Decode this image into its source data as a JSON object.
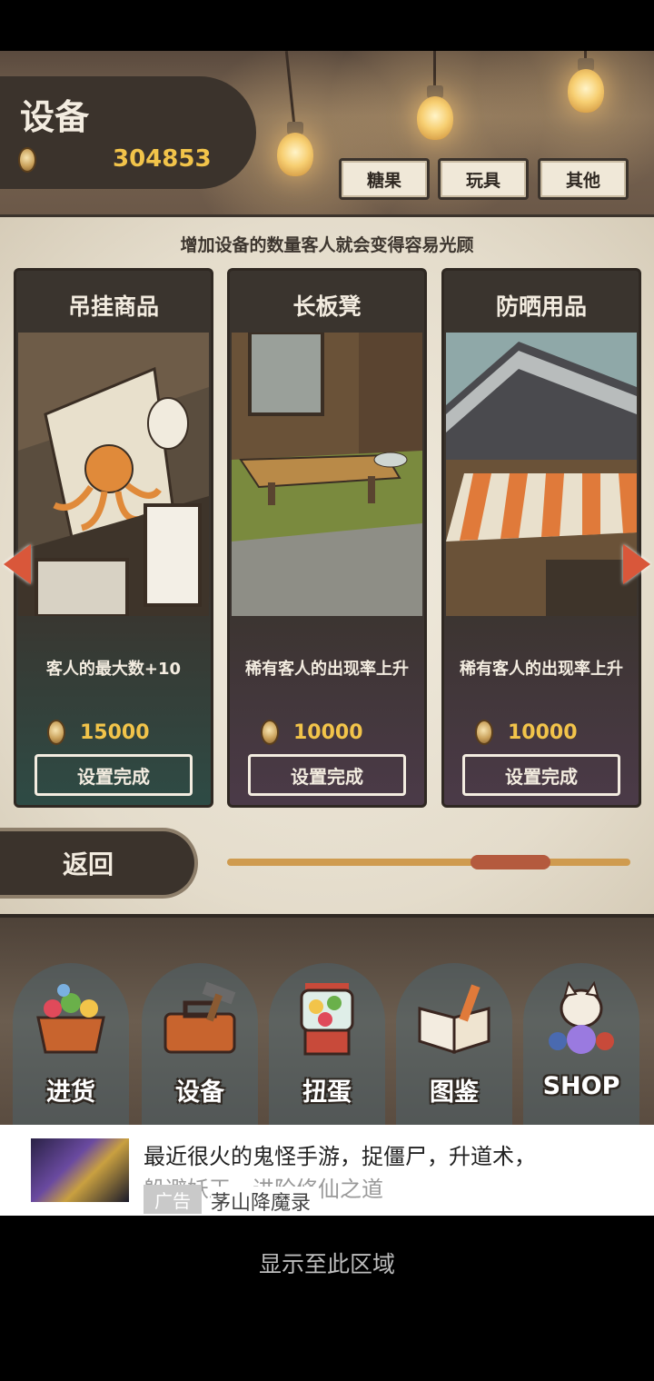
{
  "header": {
    "title": "设备",
    "coins": "304853",
    "tabs": [
      "糖果",
      "玩具",
      "其他"
    ]
  },
  "main": {
    "info": "增加设备的数量客人就会变得容易光顾",
    "cards": [
      {
        "title": "吊挂商品",
        "desc": "客人的最大数+10",
        "price": "15000",
        "button": "设置完成",
        "theme": "green"
      },
      {
        "title": "长板凳",
        "desc": "稀有客人的出现率上升",
        "price": "10000",
        "button": "设置完成",
        "theme": "purple"
      },
      {
        "title": "防晒用品",
        "desc": "稀有客人的出现率上升",
        "price": "10000",
        "button": "设置完成",
        "theme": "purple"
      }
    ],
    "back_label": "返回"
  },
  "nav": {
    "items": [
      {
        "label": "进货",
        "icon": "basket-icon"
      },
      {
        "label": "设备",
        "icon": "toolbox-icon"
      },
      {
        "label": "扭蛋",
        "icon": "gacha-machine-icon"
      },
      {
        "label": "图鉴",
        "icon": "book-icon"
      },
      {
        "label": "SHOP",
        "icon": "lucky-cat-icon"
      }
    ]
  },
  "ad": {
    "headline": "最近很火的鬼怪手游，捉僵尸，升道术，",
    "headline_2": "躲避妖王，进阶修仙之道",
    "tag": "广告",
    "source": "茅山降魔录"
  },
  "footer": {
    "text": "显示至此区域"
  },
  "colors": {
    "accent": "#f2c44a",
    "dark_panel": "#3b332c",
    "arrow": "#d9573a"
  }
}
